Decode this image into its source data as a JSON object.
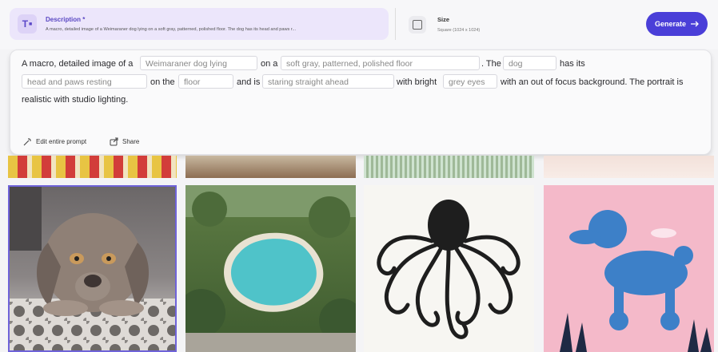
{
  "description": {
    "label": "Description *",
    "text": "A macro, detailed image of a Weimaraner dog lying on a soft gray, patterned, polished floor. The dog has its head and paws r..."
  },
  "size": {
    "label": "Size",
    "value": "Square (1024 x 1024)"
  },
  "generate_label": "Generate",
  "prompt": {
    "t1": "A macro, detailed image of a",
    "s1": "Weimaraner dog lying",
    "t2": "on a",
    "s2": "soft gray, patterned, polished floor",
    "t3": ". The",
    "s3": "dog",
    "t4": "has its",
    "s4": "head and paws resting",
    "t5": "on the",
    "s5": "floor",
    "t6": "and is",
    "s6": "staring straight ahead",
    "t7": "with bright",
    "s7": "grey eyes",
    "t8": "with an out of focus background. The portrait is",
    "t9": "realistic with studio lighting."
  },
  "actions": {
    "edit": "Edit entire prompt",
    "share": "Share"
  },
  "icons": {
    "description": "text-format-icon",
    "size": "square-icon",
    "generate": "arrow-right-icon",
    "edit": "magic-wand-icon",
    "share": "share-icon"
  },
  "colors": {
    "accent": "#4a3fd8",
    "description_bg": "#ece6fb",
    "selected_border": "#6f63d9"
  },
  "gallery": [
    {
      "name": "weimaraner-dog-image",
      "selected": true
    },
    {
      "name": "garden-pool-image",
      "selected": false
    },
    {
      "name": "octopus-illustration-image",
      "selected": false
    },
    {
      "name": "blue-poodle-illustration-image",
      "selected": false
    }
  ]
}
